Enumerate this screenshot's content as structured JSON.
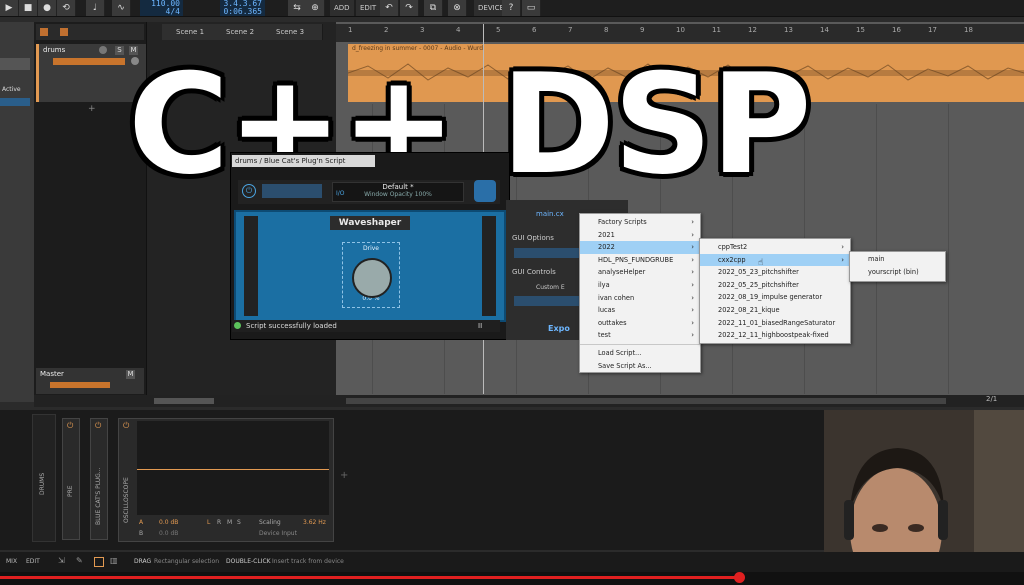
{
  "toolbar": {
    "tempo": "110.00",
    "signature": "4/4",
    "position": "3.4.3.67",
    "time": "0:06.365",
    "add_label": "ADD",
    "edit_label": "EDIT",
    "device_label": "DEVICE"
  },
  "inspector": {
    "active_label": "Active"
  },
  "tracks": {
    "drums_name": "drums",
    "master_name": "Master"
  },
  "scenes": [
    "Scene 1",
    "Scene 2",
    "Scene 3"
  ],
  "ruler_ticks": [
    "1",
    "2",
    "3",
    "4",
    "5",
    "6",
    "7",
    "8",
    "9",
    "10",
    "11",
    "12",
    "13",
    "14",
    "15",
    "16",
    "17",
    "18"
  ],
  "clip": {
    "title": "d_freezing in summer - 0007 - Audio - Wurd"
  },
  "plugin": {
    "window_title": "drums / Blue Cat's Plug'n Script",
    "preset_name": "Default *",
    "window_opacity": "Window Opacity 100%",
    "io_label": "I/O",
    "effect_title": "Waveshaper",
    "drive_label": "Drive",
    "drive_value": "0.0 %",
    "status": "Script successfully loaded",
    "pause_label": "II"
  },
  "gui_panel": {
    "main_label": "main.cx",
    "gui_options": "GUI Options",
    "gui_controls": "GUI Controls",
    "custom_label": "Custom E",
    "export_label": "Expo"
  },
  "menu1": {
    "items": [
      {
        "label": "Factory Scripts",
        "submenu": true
      },
      {
        "label": "2021",
        "submenu": true
      },
      {
        "label": "2022",
        "submenu": true,
        "selected": true
      },
      {
        "label": "HDL_PNS_FUNDGRUBE",
        "submenu": true
      },
      {
        "label": "analyseHelper",
        "submenu": true
      },
      {
        "label": "ilya",
        "submenu": true
      },
      {
        "label": "ivan cohen",
        "submenu": true
      },
      {
        "label": "lucas",
        "submenu": true
      },
      {
        "label": "outtakes",
        "submenu": true
      },
      {
        "label": "test",
        "submenu": true
      }
    ],
    "actions": [
      "Load Script...",
      "Save Script As..."
    ]
  },
  "menu2": {
    "items": [
      {
        "label": "cppTest2",
        "submenu": true
      },
      {
        "label": "cxx2cpp",
        "submenu": true,
        "selected": true
      },
      {
        "label": "2022_05_23_pitchshifter",
        "submenu": false
      },
      {
        "label": "2022_05_25_pitchshifter",
        "submenu": false
      },
      {
        "label": "2022_08_19_impulse generator",
        "submenu": false
      },
      {
        "label": "2022_08_21_kique",
        "submenu": false
      },
      {
        "label": "2022_11_01_biasedRangeSaturator",
        "submenu": false
      },
      {
        "label": "2022_12_11_highboostpeak-fixed",
        "submenu": false
      }
    ]
  },
  "menu3": {
    "items": [
      {
        "label": "main"
      },
      {
        "label": "yourscript (bin)"
      }
    ]
  },
  "overlay_title": "C++ DSP",
  "device_panel": {
    "drums_label": "DRUMS",
    "pre_label": "PRE",
    "bluecat_label": "BLUE CAT'S PLUG...",
    "scope_label": "OSCILLOSCOPE",
    "channel_a": "A",
    "channel_b": "B",
    "a_db": "0.0 dB",
    "b_db": "0.0 dB",
    "lr_labels": [
      "L",
      "R",
      "M",
      "S"
    ],
    "scaling_label": "Scaling",
    "scaling_value": "3.62 Hz",
    "device_input": "Device Input"
  },
  "bottom_bar": {
    "mix": "MIX",
    "edit": "EDIT",
    "drag_key": "DRAG",
    "drag_hint": "Rectangular selection",
    "dblclick_key": "DOUBLE-CLICK",
    "dblclick_hint": "Insert track from device",
    "page_indicator": "2/1"
  },
  "colors": {
    "accent_orange": "#e39a52",
    "plugin_blue": "#1b6fa3",
    "menu_highlight": "#9fd0f5"
  }
}
